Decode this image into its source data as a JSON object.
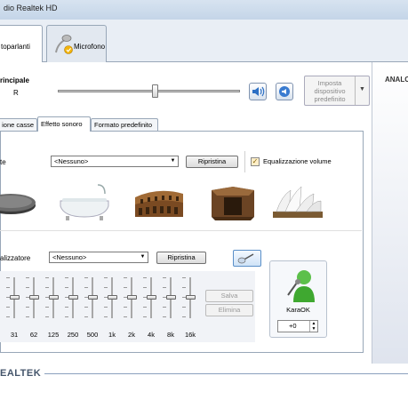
{
  "window": {
    "title": "dio Realtek HD"
  },
  "device_tabs": [
    {
      "label": "toparlanti"
    },
    {
      "label": "Microfono"
    }
  ],
  "right_panel": {
    "label": "ANALO"
  },
  "main_volume": {
    "label": "rincipale",
    "channel_label": "R",
    "volume_level": 0.5
  },
  "set_default": {
    "label": "Imposta dispositivo predefinito"
  },
  "tabs": [
    {
      "label": "ione casse"
    },
    {
      "label": "Effetto sonoro"
    },
    {
      "label": "Formato predefinito"
    }
  ],
  "environment": {
    "label": "te",
    "selected": "<Nessuno>",
    "reset_label": "Ripristina",
    "equalize_checkbox": {
      "label": "Equalizzazione volume",
      "checked": true
    },
    "items": [
      {
        "icon": "padded-cell-icon"
      },
      {
        "icon": "bathroom-icon"
      },
      {
        "icon": "colosseum-icon"
      },
      {
        "icon": "stone-corridor-icon"
      },
      {
        "icon": "opera-house-icon"
      }
    ]
  },
  "equalizer": {
    "label": "alizzatore",
    "selected": "<Nessuno>",
    "reset_label": "Ripristina",
    "bands": [
      {
        "freq": "31",
        "level": 0.5
      },
      {
        "freq": "62",
        "level": 0.5
      },
      {
        "freq": "125",
        "level": 0.5
      },
      {
        "freq": "250",
        "level": 0.5
      },
      {
        "freq": "500",
        "level": 0.5
      },
      {
        "freq": "1k",
        "level": 0.5
      },
      {
        "freq": "2k",
        "level": 0.5
      },
      {
        "freq": "4k",
        "level": 0.5
      },
      {
        "freq": "8k",
        "level": 0.5
      },
      {
        "freq": "16k",
        "level": 0.5
      }
    ],
    "save_label": "Salva",
    "delete_label": "Elimina"
  },
  "karaoke": {
    "label": "KaraOK",
    "value": "+0"
  },
  "footer": {
    "brand": "EALTEK"
  },
  "colors": {
    "accent": "#3c78c8",
    "panel": "#f0f0f0",
    "brand": "#44556b"
  }
}
